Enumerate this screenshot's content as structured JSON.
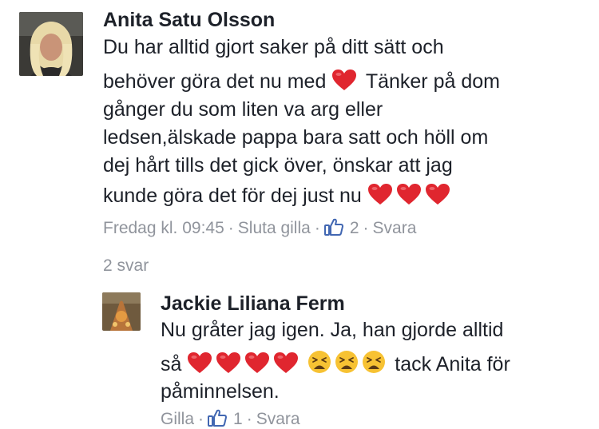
{
  "comment": {
    "author": "Anita Satu Olsson",
    "lines": [
      "Du har alltid gjort saker på ditt sätt och",
      "behöver göra det nu med",
      "Tänker på dom",
      "gånger du som liten va arg eller",
      "ledsen,älskade pappa bara satt och höll om",
      "dej hårt tills det gick över, önskar att jag",
      "kunde göra det för dej just nu"
    ],
    "time": "Fredag kl. 09:45",
    "unlike_label": "Sluta gilla",
    "like_count": "2",
    "reply_label": "Svara"
  },
  "replies_count": "2 svar",
  "reply": {
    "author": "Jackie Liliana Ferm",
    "lines": [
      "Nu gråter jag igen. Ja, han gjorde alltid",
      "så",
      "tack Anita för",
      "påminnelsen."
    ],
    "like_label": "Gilla",
    "like_count": "1",
    "reply_label": "Svara"
  },
  "colors": {
    "text": "#1d2129",
    "meta": "#90949c",
    "like_blue": "#4267b2",
    "heart": "#e0262f"
  },
  "icons": [
    "heart-emoji",
    "weary-face-emoji",
    "thumbs-up-icon"
  ]
}
